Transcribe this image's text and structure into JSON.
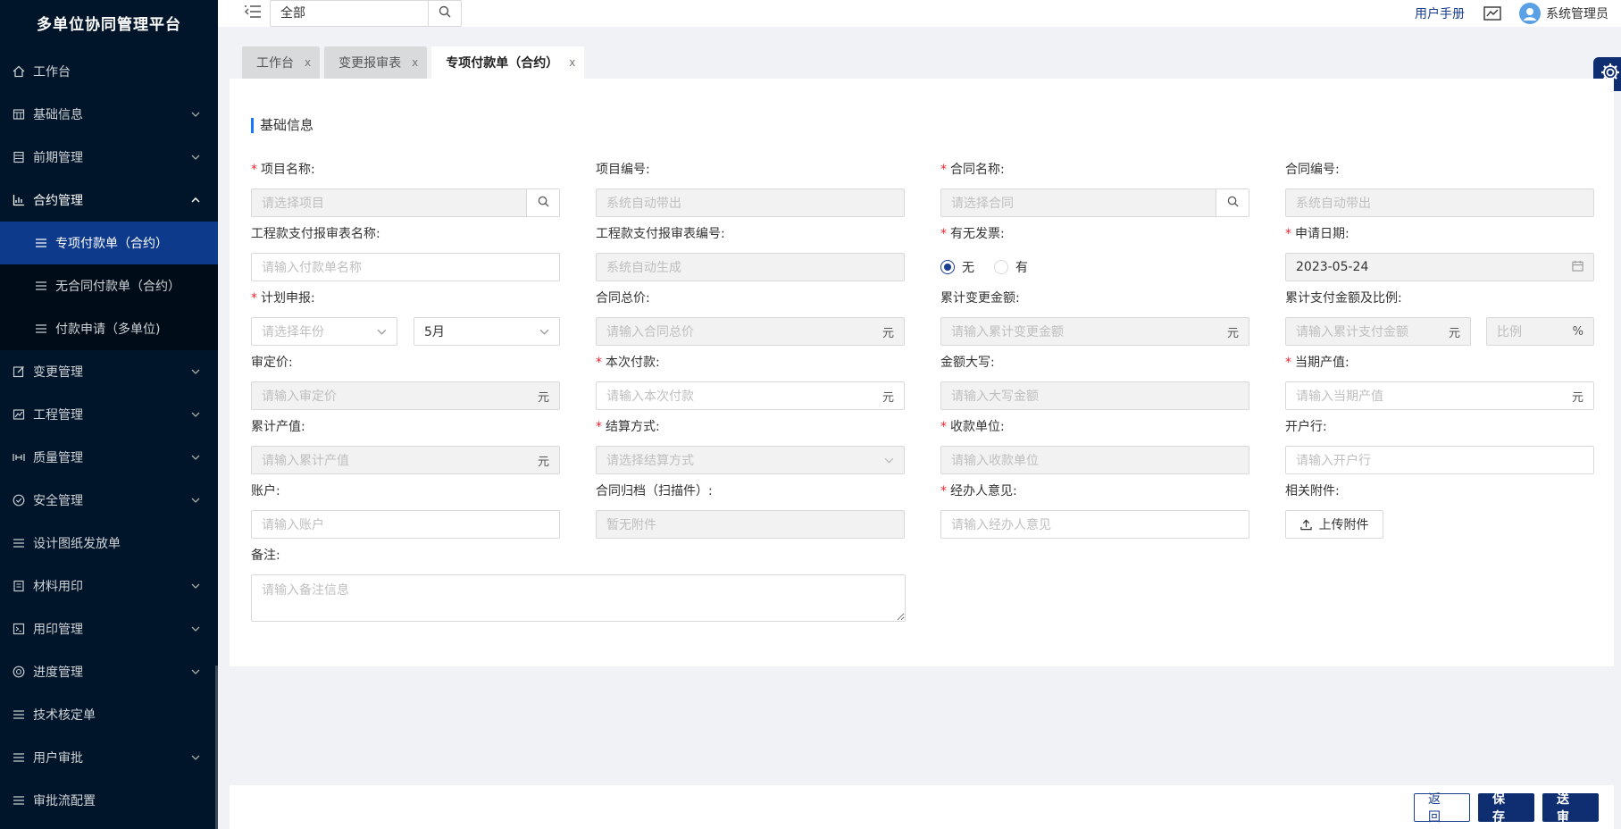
{
  "app": {
    "title": "多单位协同管理平台"
  },
  "sidebar": {
    "items": [
      {
        "label": "工作台",
        "icon": "home-icon"
      },
      {
        "label": "基础信息",
        "icon": "database-icon"
      },
      {
        "label": "前期管理",
        "icon": "file-icon"
      },
      {
        "label": "合约管理",
        "icon": "chart-icon",
        "expanded": true
      },
      {
        "label": "变更管理",
        "icon": "edit-icon"
      },
      {
        "label": "工程管理",
        "icon": "line-chart-icon"
      },
      {
        "label": "质量管理",
        "icon": "quality-icon"
      },
      {
        "label": "安全管理",
        "icon": "check-circle-icon"
      },
      {
        "label": "设计图纸发放单",
        "icon": "menu-icon"
      },
      {
        "label": "材料用印",
        "icon": "doc-icon"
      },
      {
        "label": "用印管理",
        "icon": "seal-icon"
      },
      {
        "label": "进度管理",
        "icon": "progress-icon"
      },
      {
        "label": "技术核定单",
        "icon": "menu-icon"
      },
      {
        "label": "用户审批",
        "icon": "menu-icon"
      },
      {
        "label": "审批流配置",
        "icon": "menu-icon"
      }
    ],
    "submenu": [
      {
        "label": "专项付款单（合约）",
        "active": true
      },
      {
        "label": "无合同付款单（合约）",
        "active": false
      },
      {
        "label": "付款申请（多单位)",
        "active": false
      }
    ]
  },
  "header": {
    "search_value": "全部",
    "manual_label": "用户手册",
    "user_name": "系统管理员"
  },
  "tabs": [
    {
      "label": "工作台",
      "close": "x"
    },
    {
      "label": "变更报审表",
      "close": "x"
    },
    {
      "label": "专项付款单（合约）",
      "close": "x",
      "active": true
    }
  ],
  "form": {
    "section_title": "基础信息",
    "fields": {
      "project_name": {
        "label": "项目名称:",
        "placeholder": "请选择项目",
        "required": "*"
      },
      "project_no": {
        "label": "项目编号:",
        "placeholder": "系统自动带出"
      },
      "contract_name": {
        "label": "合同名称:",
        "placeholder": "请选择合同",
        "required": "*"
      },
      "contract_no": {
        "label": "合同编号:",
        "placeholder": "系统自动带出"
      },
      "report_name": {
        "label": "工程款支付报审表名称:",
        "placeholder": "请输入付款单名称"
      },
      "report_no": {
        "label": "工程款支付报审表编号:",
        "placeholder": "系统自动生成"
      },
      "invoice": {
        "label": "有无发票:",
        "required": "*",
        "options": [
          "无",
          "有"
        ],
        "selected": "无"
      },
      "apply_date": {
        "label": "申请日期:",
        "value": "2023-05-24",
        "required": "*"
      },
      "plan": {
        "label": "计划申报:",
        "year_placeholder": "请选择年份",
        "month_value": "5月",
        "required": "*"
      },
      "contract_total": {
        "label": "合同总价:",
        "placeholder": "请输入合同总价",
        "suffix": "元"
      },
      "change_total": {
        "label": "累计变更金额:",
        "placeholder": "请输入累计变更金额",
        "suffix": "元"
      },
      "paid_total": {
        "label": "累计支付金额及比例:",
        "placeholder": "请输入累计支付金额",
        "suffix": "元",
        "ratio_placeholder": "比例",
        "ratio_suffix": "%"
      },
      "approved_price": {
        "label": "审定价:",
        "placeholder": "请输入审定价",
        "suffix": "元"
      },
      "current_pay": {
        "label": "本次付款:",
        "placeholder": "请输入本次付款",
        "suffix": "元",
        "required": "*"
      },
      "amount_upper": {
        "label": "金额大写:",
        "placeholder": "请输入大写金额"
      },
      "current_output": {
        "label": "当期产值:",
        "placeholder": "请输入当期产值",
        "suffix": "元",
        "required": "*"
      },
      "total_output": {
        "label": "累计产值:",
        "placeholder": "请输入累计产值",
        "suffix": "元"
      },
      "settle_method": {
        "label": "结算方式:",
        "placeholder": "请选择结算方式",
        "required": "*"
      },
      "payee": {
        "label": "收款单位:",
        "placeholder": "请输入收款单位",
        "required": "*"
      },
      "bank": {
        "label": "开户行:",
        "placeholder": "请输入开户行"
      },
      "account": {
        "label": "账户:",
        "placeholder": "请输入账户"
      },
      "archive": {
        "label": "合同归档（扫描件）:",
        "placeholder": "暂无附件"
      },
      "handler_opinion": {
        "label": "经办人意见:",
        "placeholder": "请输入经办人意见",
        "required": "*"
      },
      "attachments": {
        "label": "相关附件:",
        "button": "上传附件"
      },
      "remark": {
        "label": "备注:",
        "placeholder": "请输入备注信息"
      }
    }
  },
  "footer": {
    "back": "返回",
    "save": "保存",
    "submit": "送审"
  },
  "colors": {
    "sidebar_bg": "#001529",
    "primary": "#0f2e72",
    "active_menu": "#0e3a8c",
    "required": "#f5222d"
  }
}
